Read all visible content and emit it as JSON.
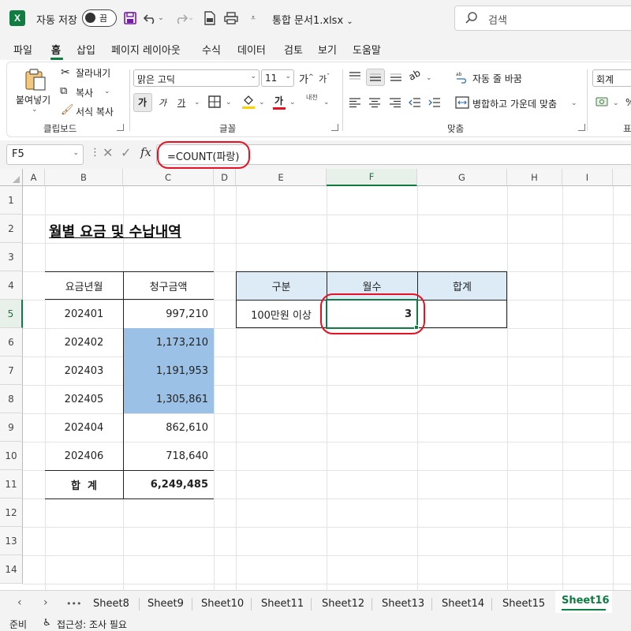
{
  "titlebar": {
    "app_logo": "X",
    "autosave_label": "자동 저장",
    "autosave_state": "끔",
    "doc_title": "통합 문서1.xlsx",
    "search_placeholder": "검색"
  },
  "menu": [
    "파일",
    "홈",
    "삽입",
    "페이지 레이아웃",
    "수식",
    "데이터",
    "검토",
    "보기",
    "도움말"
  ],
  "ribbon": {
    "paste_label": "붙여넣기",
    "cut_label": "잘라내기",
    "copy_label": "복사",
    "format_painter_label": "서식 복사",
    "clipboard_group": "클립보드",
    "font_name": "맑은 고딕",
    "font_size": "11",
    "grow_font": "가",
    "shrink_font": "가",
    "bold_label": "가",
    "italic_label": "가",
    "underline_label": "가",
    "font_color_label": "가",
    "phonetic_label": "내천",
    "font_group": "글꼴",
    "wrap_label": "자동 줄 바꿈",
    "merge_label": "병합하고 가운데 맞춤",
    "align_group": "맞춤",
    "number_format": "회계",
    "number_group": "표"
  },
  "formula_bar": {
    "name_box": "F5",
    "fx": "fx",
    "formula": "=COUNT(파랑)"
  },
  "columns": [
    "A",
    "B",
    "C",
    "D",
    "E",
    "F",
    "G",
    "H",
    "I"
  ],
  "rows": [
    "1",
    "2",
    "3",
    "4",
    "5",
    "6",
    "7",
    "8",
    "9",
    "10",
    "11",
    "12",
    "13",
    "14"
  ],
  "sheet": {
    "title": "월별 요금 및 수납내역",
    "table_headers": [
      "요금년월",
      "청구금액"
    ],
    "table_rows": [
      {
        "month": "202401",
        "amount": "997,210"
      },
      {
        "month": "202402",
        "amount": "1,173,210"
      },
      {
        "month": "202403",
        "amount": "1,191,953"
      },
      {
        "month": "202405",
        "amount": "1,305,861"
      },
      {
        "month": "202404",
        "amount": "862,610"
      },
      {
        "month": "202406",
        "amount": "718,640"
      }
    ],
    "total_label": "합  계",
    "total_value": "6,249,485",
    "summary_headers": [
      "구분",
      "월수",
      "합계"
    ],
    "summary_label": "100만원 이상",
    "summary_count": "3",
    "summary_total": "",
    "highlight_color": "#9bc2e6",
    "header_fill_color": "#ddebf7"
  },
  "sheet_tabs": [
    "Sheet8",
    "Sheet9",
    "Sheet10",
    "Sheet11",
    "Sheet12",
    "Sheet13",
    "Sheet14",
    "Sheet15"
  ],
  "active_sheet": "Sheet16",
  "tab_overflow": "•••",
  "status": {
    "ready": "준비",
    "accessibility": "접근성: 조사 필요"
  },
  "colors": {
    "excel_green": "#107c41",
    "annotation_red": "#e81123"
  }
}
